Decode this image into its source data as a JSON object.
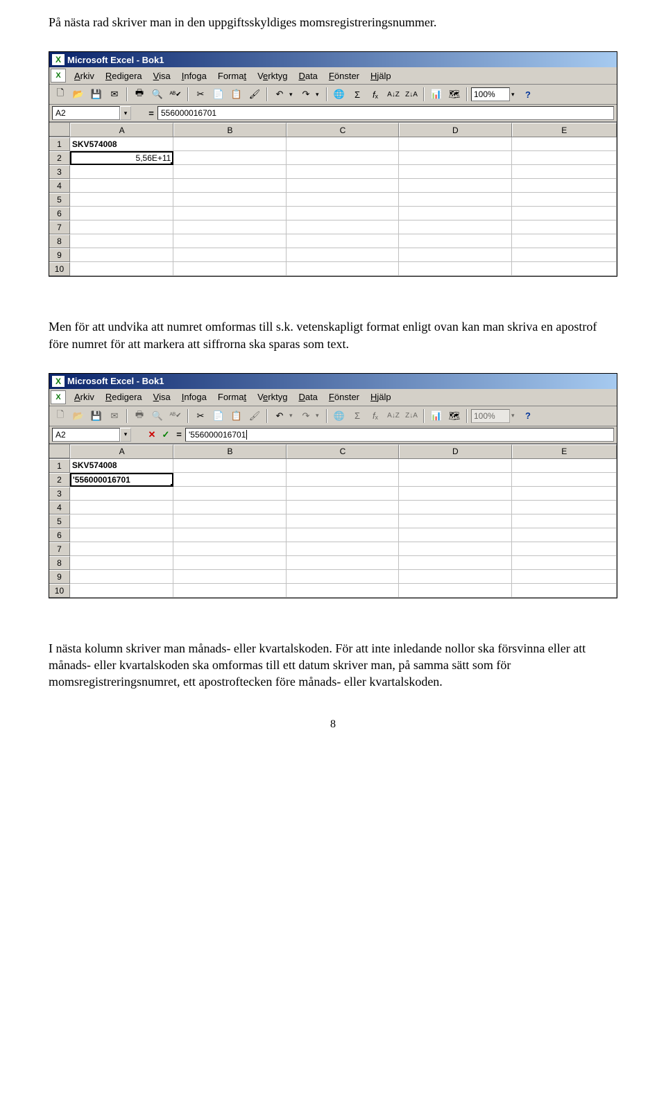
{
  "paragraphs": {
    "p1": "På nästa rad skriver man in den uppgiftsskyldiges momsregistreringsnummer.",
    "p2": "Men för att undvika att numret omformas till s.k. vetenskapligt format enligt ovan kan man skriva en apostrof före numret för att markera att siffrorna ska sparas som text.",
    "p3": "I nästa kolumn skriver man månads- eller kvartalskoden. För att inte inledande nollor ska försvinna eller att månads- eller kvartalskoden ska omformas till ett datum skriver man, på samma sätt som för momsregistreringsnumret, ett apostroftecken före månads- eller kvartalskoden."
  },
  "excel": {
    "title": "Microsoft Excel - Bok1",
    "menu": {
      "arkiv": "Arkiv",
      "redigera": "Redigera",
      "visa": "Visa",
      "infoga": "Infoga",
      "format": "Format",
      "verktyg": "Verktyg",
      "data": "Data",
      "fonster": "Fönster",
      "hjalp": "Hjälp"
    },
    "zoom": "100%",
    "columns": [
      "A",
      "B",
      "C",
      "D",
      "E"
    ],
    "rows": [
      "1",
      "2",
      "3",
      "4",
      "5",
      "6",
      "7",
      "8",
      "9",
      "10"
    ]
  },
  "shot1": {
    "namebox": "A2",
    "formula": "556000016701",
    "cells": {
      "A1": "SKV574008",
      "A2": "5,56E+11"
    }
  },
  "shot2": {
    "namebox": "A2",
    "formula": "'556000016701",
    "cells": {
      "A1": "SKV574008",
      "A2": "'556000016701"
    }
  },
  "page_number": "8",
  "colwidths": {
    "A": 150,
    "B": 163,
    "C": 163,
    "D": 163,
    "E": 152
  }
}
